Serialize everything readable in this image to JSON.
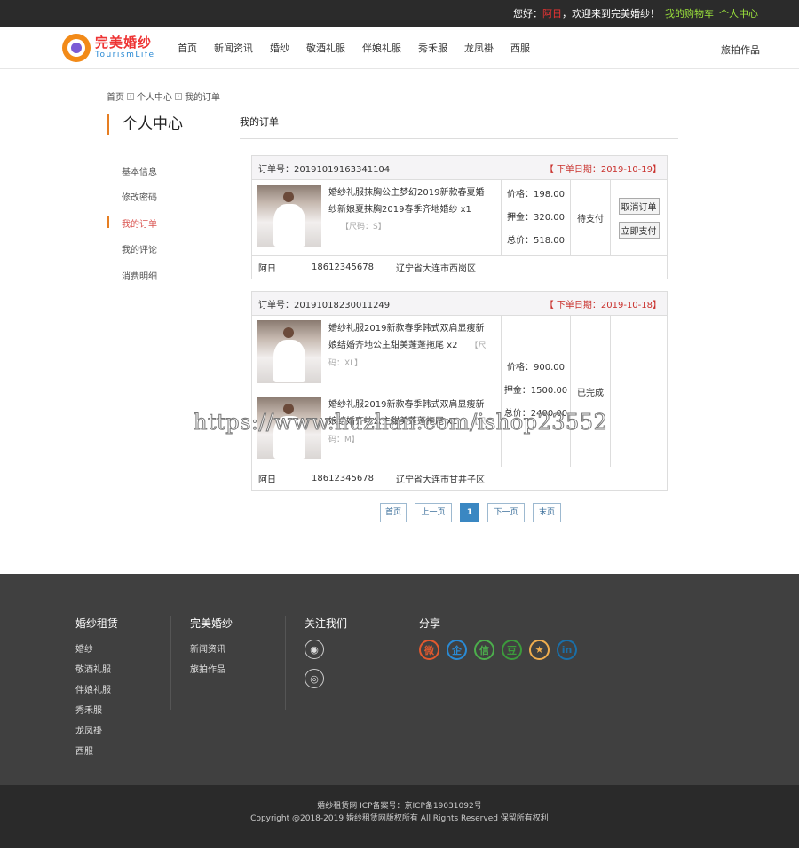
{
  "topbar": {
    "greeting": "您好：",
    "user": "阿日",
    "welcome": "，欢迎来到完美婚纱！",
    "cart": "我的购物车",
    "center": "个人中心"
  },
  "logo": {
    "cn": "完美婚纱",
    "en": "TourismLife"
  },
  "menu": [
    "首页",
    "新闻资讯",
    "婚纱",
    "敬酒礼服",
    "伴娘礼服",
    "秀禾服",
    "龙凤褂",
    "西服"
  ],
  "nav_right": "旅拍作品",
  "breadcrumb": [
    "首页",
    "个人中心",
    "我的订单"
  ],
  "sidebar": {
    "title": "个人中心",
    "items": [
      "基本信息",
      "修改密码",
      "我的订单",
      "我的评论",
      "消费明细"
    ]
  },
  "main": {
    "title": "我的订单"
  },
  "orders": [
    {
      "number": "订单号：20191019163341104",
      "date": "【 下单日期：2019-10-19】",
      "goods": [
        {
          "title": "婚纱礼服抹胸公主梦幻2019新款春夏婚纱新娘夏抹胸2019春季齐地婚纱",
          "qty": "x1",
          "size": "【尺码：S】"
        }
      ],
      "price": "价格：198.00",
      "deposit": "押金：320.00",
      "total": "总价：518.00",
      "status": "待支付",
      "actions": [
        "取消订单",
        "立即支付"
      ],
      "name": "阿日",
      "phone": "18612345678",
      "address": "辽宁省大连市西岗区"
    },
    {
      "number": "订单号：20191018230011249",
      "date": "【 下单日期：2019-10-18】",
      "goods": [
        {
          "title": "婚纱礼服2019新款春季韩式双肩显瘦新娘结婚齐地公主甜美蓬蓬拖尾",
          "qty": "x2",
          "size": "【尺码：XL】"
        },
        {
          "title": "婚纱礼服2019新款春季韩式双肩显瘦新娘结婚齐地公主甜美蓬蓬拖尾",
          "qty": "x1",
          "size": "【尺码：M】"
        }
      ],
      "price": "价格：900.00",
      "deposit": "押金：1500.00",
      "total": "总价：2400.00",
      "status": "已完成",
      "actions": [],
      "name": "阿日",
      "phone": "18612345678",
      "address": "辽宁省大连市甘井子区"
    }
  ],
  "pager": {
    "first": "首页",
    "prev": "上一页",
    "current": "1",
    "next": "下一页",
    "last": "末页"
  },
  "footer": {
    "cols": [
      {
        "title": "婚纱租赁",
        "links": [
          "婚纱",
          "敬酒礼服",
          "伴娘礼服",
          "秀禾服",
          "龙凤褂",
          "西服"
        ]
      },
      {
        "title": "完美婚纱",
        "links": [
          "新闻资讯",
          "旅拍作品"
        ]
      },
      {
        "title": "关注我们",
        "icons": [
          "wechat-icon",
          "weibo-icon"
        ]
      },
      {
        "title": "分享",
        "icons": [
          "weibo-share-icon",
          "qq-share-icon",
          "wechat-share-icon",
          "douban-share-icon",
          "qzone-share-icon",
          "linkedin-share-icon"
        ]
      }
    ],
    "share_glyphs": [
      "微",
      "企",
      "信",
      "豆",
      "★",
      "in"
    ],
    "icp": "婚纱租赁网 ICP备案号：京ICP备19031092号",
    "copyright": "Copyright @2018-2019 婚纱租赁网版权所有 All Rights Reserved 保留所有权利"
  },
  "watermark": "https://www.huzhan.com/ishop23552",
  "colors": {
    "accent": "#e67e22",
    "date_red": "#c9302c",
    "pager_blue": "#3a87c2",
    "footer_bg": "#404040",
    "bottom_bg": "#2a2a2a"
  }
}
